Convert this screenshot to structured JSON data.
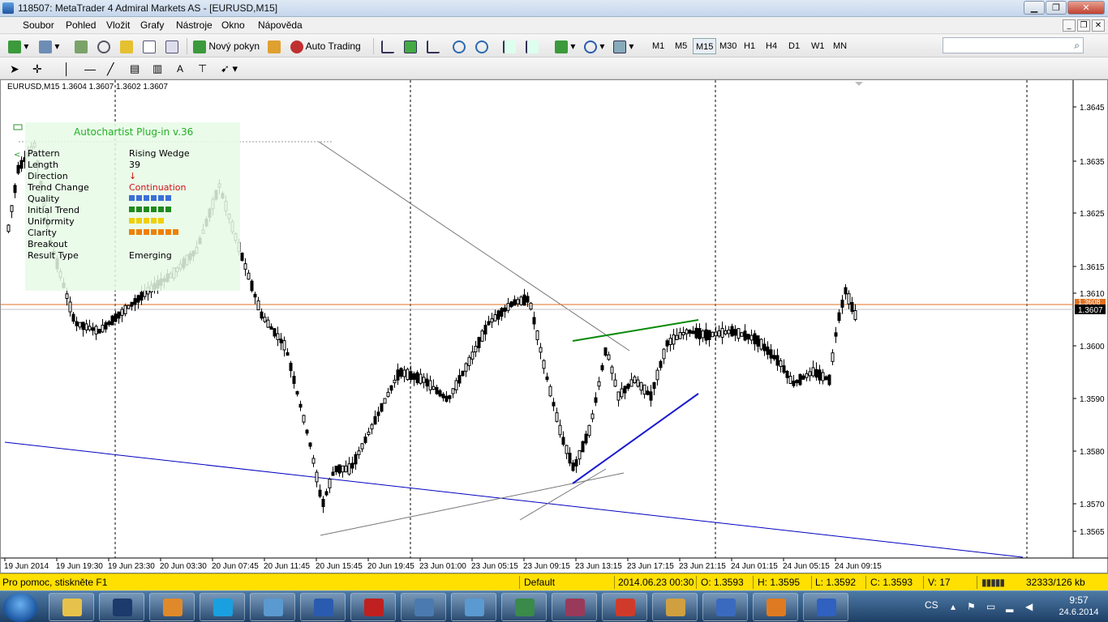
{
  "window": {
    "title": "118507: MetaTrader 4 Admiral Markets AS - [EURUSD,M15]",
    "min_label": "▁",
    "max_label": "❐",
    "close_label": "✕"
  },
  "menu": [
    "Soubor",
    "Pohled",
    "Vložit",
    "Grafy",
    "Nástroje",
    "Okno",
    "Nápověda"
  ],
  "toolbar": {
    "new_order": "Nový pokyn",
    "auto_trading": "Auto Trading",
    "timeframes": [
      "M1",
      "M5",
      "M15",
      "M30",
      "H1",
      "H4",
      "D1",
      "W1",
      "MN"
    ],
    "selected_timeframe": "M15",
    "search_placeholder": ""
  },
  "chart": {
    "header": "EURUSD,M15  1.3604 1.3607 1.3602 1.3607",
    "price_levels": [
      "1.3645",
      "1.3635",
      "1.3625",
      "1.3615",
      "1.3610",
      "1.3600",
      "1.3590",
      "1.3580",
      "1.3570",
      "1.3565"
    ],
    "time_labels": [
      "19 Jun 2014",
      "19 Jun 19:30",
      "19 Jun 23:30",
      "20 Jun 03:30",
      "20 Jun 07:45",
      "20 Jun 11:45",
      "20 Jun 15:45",
      "20 Jun 19:45",
      "23 Jun 01:00",
      "23 Jun 05:15",
      "23 Jun 09:15",
      "23 Jun 13:15",
      "23 Jun 17:15",
      "23 Jun 21:15",
      "24 Jun 01:15",
      "24 Jun 05:15",
      "24 Jun 09:15"
    ],
    "bid_label": "1.3607",
    "ask_label": "1.3608",
    "colors": {
      "bid_line": "#c0c0c0",
      "ask_line": "#e07020",
      "trend_blue": "#0000c0",
      "resistance_green": "#0a8a0a",
      "support_blue": "#1a1ad0"
    }
  },
  "autochartist": {
    "title": "Autochartist Plug-in v.36",
    "rows": [
      {
        "label": "Pattern",
        "value": "Rising Wedge"
      },
      {
        "label": "Length",
        "value": "39"
      },
      {
        "label": "Direction",
        "value": "↓"
      },
      {
        "label": "Trend Change",
        "value": "Continuation"
      },
      {
        "label": "Quality",
        "value": "",
        "bar_color": "#3a6fd8",
        "squares": 6
      },
      {
        "label": "Initial Trend",
        "value": "",
        "bar_color": "#1e8a1e",
        "squares": 6
      },
      {
        "label": "Uniformity",
        "value": "",
        "bar_color": "#f0d000",
        "squares": 5
      },
      {
        "label": "Clarity",
        "value": "",
        "bar_color": "#f08000",
        "squares": 7
      },
      {
        "label": "Breakout",
        "value": ""
      },
      {
        "label": "Result Type",
        "value": "Emerging"
      }
    ]
  },
  "status": {
    "help": "Pro pomoc, stiskněte F1",
    "profile": "Default",
    "datetime": "2014.06.23 00:30",
    "open": "O: 1.3593",
    "high": "H: 1.3595",
    "low": "L: 1.3592",
    "close": "C: 1.3593",
    "volume": "V: 17",
    "traffic": "32333/126 kb"
  },
  "taskbar": {
    "apps": [
      "explorer",
      "hp",
      "media-player",
      "skype",
      "control-panel",
      "word",
      "acrobat",
      "calculator",
      "photos",
      "metatrader",
      "access",
      "chrome",
      "paint",
      "wordpad",
      "pinball",
      "chart-app"
    ],
    "language": "CS",
    "time": "9:57",
    "date": "24.6.2014"
  }
}
